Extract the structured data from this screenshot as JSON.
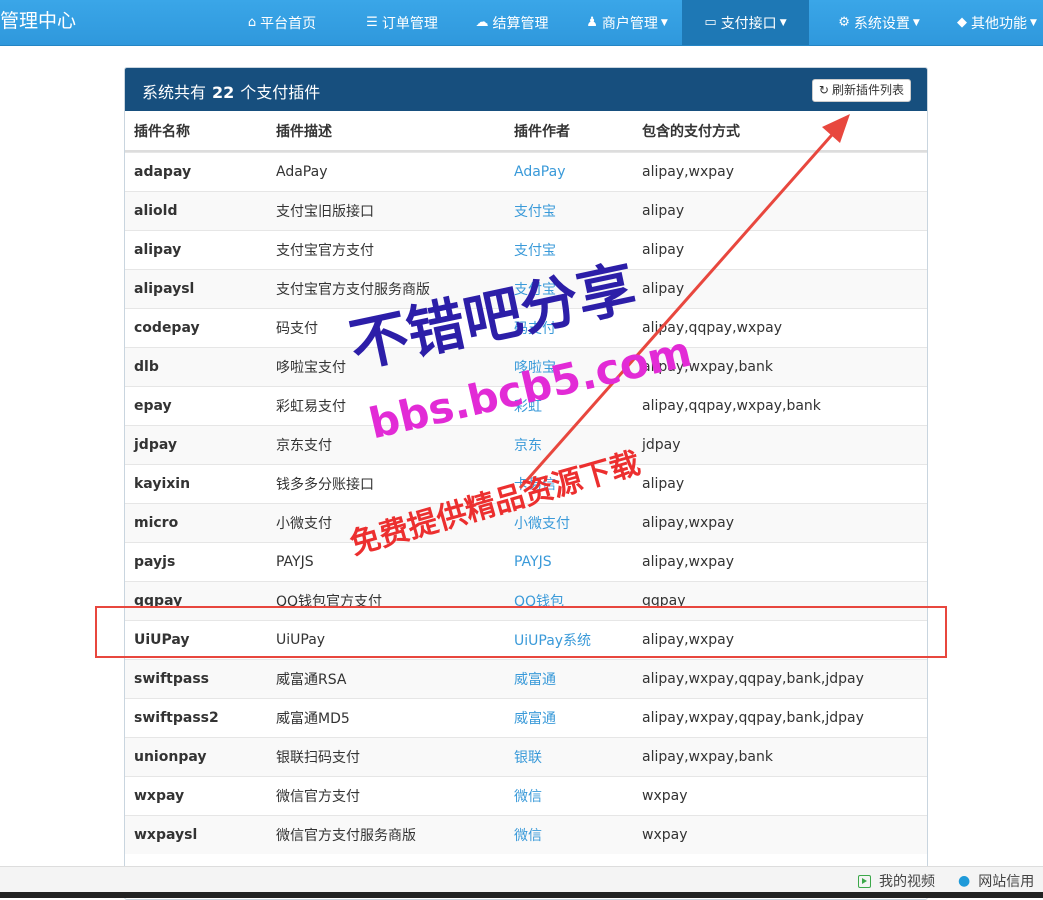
{
  "nav": {
    "brand": "管理中心",
    "items": [
      {
        "label": "平台首页",
        "icon": "home-icon",
        "glyph": "⌂",
        "caret": false,
        "active": false
      },
      {
        "label": "订单管理",
        "icon": "list-icon",
        "glyph": "☰",
        "caret": false,
        "active": false
      },
      {
        "label": "结算管理",
        "icon": "cloud-icon",
        "glyph": "☁",
        "caret": false,
        "active": false
      },
      {
        "label": "商户管理",
        "icon": "user-icon",
        "glyph": "♟",
        "caret": true,
        "active": false
      },
      {
        "label": "支付接口",
        "icon": "credit-card-icon",
        "glyph": "▭",
        "caret": true,
        "active": true
      },
      {
        "label": "系统设置",
        "icon": "gear-icon",
        "glyph": "⚙",
        "caret": true,
        "active": false
      },
      {
        "label": "其他功能",
        "icon": "cube-icon",
        "glyph": "◆",
        "caret": true,
        "active": false
      }
    ]
  },
  "panel": {
    "title_prefix": "系统共有",
    "count": "22",
    "title_suffix": "个支付插件",
    "refresh_label": "刷新插件列表"
  },
  "table": {
    "headers": [
      "插件名称",
      "插件描述",
      "插件作者",
      "包含的支付方式"
    ],
    "rows": [
      {
        "name": "adapay",
        "desc": "AdaPay",
        "author": "AdaPay",
        "methods": "alipay,wxpay"
      },
      {
        "name": "aliold",
        "desc": "支付宝旧版接口",
        "author": "支付宝",
        "methods": "alipay"
      },
      {
        "name": "alipay",
        "desc": "支付宝官方支付",
        "author": "支付宝",
        "methods": "alipay"
      },
      {
        "name": "alipaysl",
        "desc": "支付宝官方支付服务商版",
        "author": "支付宝",
        "methods": "alipay"
      },
      {
        "name": "codepay",
        "desc": "码支付",
        "author": "码支付",
        "methods": "alipay,qqpay,wxpay"
      },
      {
        "name": "dlb",
        "desc": "哆啦宝支付",
        "author": "哆啦宝",
        "methods": "alipay,wxpay,bank"
      },
      {
        "name": "epay",
        "desc": "彩虹易支付",
        "author": "彩虹",
        "methods": "alipay,qqpay,wxpay,bank"
      },
      {
        "name": "jdpay",
        "desc": "京东支付",
        "author": "京东",
        "methods": "jdpay"
      },
      {
        "name": "kayixin",
        "desc": "钱多多分账接口",
        "author": "卡易信",
        "methods": "alipay"
      },
      {
        "name": "micro",
        "desc": "小微支付",
        "author": "小微支付",
        "methods": "alipay,wxpay"
      },
      {
        "name": "payjs",
        "desc": "PAYJS",
        "author": "PAYJS",
        "methods": "alipay,wxpay"
      },
      {
        "name": "qqpay",
        "desc": "QQ钱包官方支付",
        "author": "QQ钱包",
        "methods": "qqpay"
      },
      {
        "name": "UiUPay",
        "desc": "UiUPay",
        "author": "UiUPay系统",
        "methods": "alipay,wxpay"
      },
      {
        "name": "swiftpass",
        "desc": "威富通RSA",
        "author": "威富通",
        "methods": "alipay,wxpay,qqpay,bank,jdpay"
      },
      {
        "name": "swiftpass2",
        "desc": "威富通MD5",
        "author": "威富通",
        "methods": "alipay,wxpay,qqpay,bank,jdpay"
      },
      {
        "name": "unionpay",
        "desc": "银联扫码支付",
        "author": "银联",
        "methods": "alipay,wxpay,bank"
      },
      {
        "name": "wxpay",
        "desc": "微信官方支付",
        "author": "微信",
        "methods": "wxpay"
      },
      {
        "name": "wxpaysl",
        "desc": "微信官方支付服务商版",
        "author": "微信",
        "methods": "wxpay"
      }
    ]
  },
  "watermark": {
    "line1": "不错吧分享",
    "line2": "bbs.bcb5.com",
    "line3": "免费提供精品资源下载"
  },
  "colors": {
    "nav_bg": "#3aa6e8",
    "nav_active": "#1e78b5",
    "panel_header": "#174f7e",
    "link": "#3a9ad9",
    "annotation_red": "#e8473e"
  },
  "bottom_bar": {
    "video_label": "我的视频",
    "credit_label": "网站信用"
  }
}
